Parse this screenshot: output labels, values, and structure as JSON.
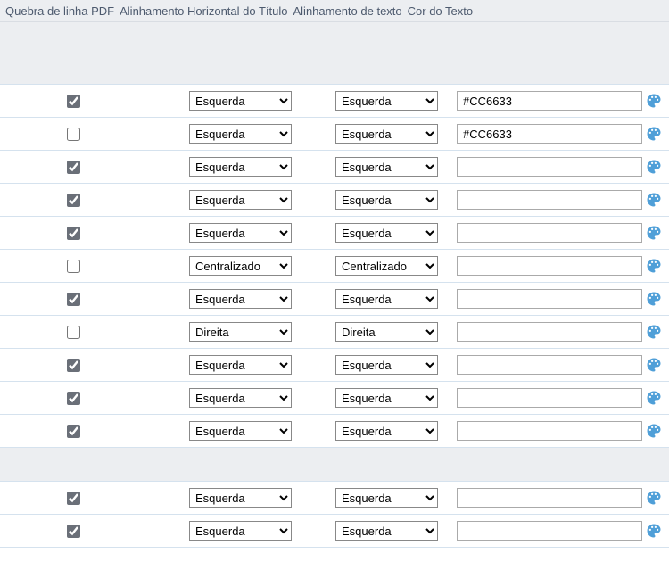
{
  "headers": {
    "col1": "Quebra de linha PDF",
    "col2": "Alinhamento Horizontal do Título",
    "col3": "Alinhamento de texto",
    "col4": "Cor do Texto"
  },
  "align_options": {
    "left": "Esquerda",
    "center": "Centralizado",
    "right": "Direita"
  },
  "rows_group1": [
    {
      "check": true,
      "align_title": "left",
      "align_text": "left",
      "color": "#CC6633"
    },
    {
      "check": false,
      "align_title": "left",
      "align_text": "left",
      "color": "#CC6633"
    },
    {
      "check": true,
      "align_title": "left",
      "align_text": "left",
      "color": ""
    },
    {
      "check": true,
      "align_title": "left",
      "align_text": "left",
      "color": ""
    },
    {
      "check": true,
      "align_title": "left",
      "align_text": "left",
      "color": ""
    },
    {
      "check": false,
      "align_title": "center",
      "align_text": "center",
      "color": ""
    },
    {
      "check": true,
      "align_title": "left",
      "align_text": "left",
      "color": ""
    },
    {
      "check": false,
      "align_title": "right",
      "align_text": "right",
      "color": ""
    },
    {
      "check": true,
      "align_title": "left",
      "align_text": "left",
      "color": ""
    },
    {
      "check": true,
      "align_title": "left",
      "align_text": "left",
      "color": ""
    },
    {
      "check": true,
      "align_title": "left",
      "align_text": "left",
      "color": ""
    }
  ],
  "rows_group2": [
    {
      "check": true,
      "align_title": "left",
      "align_text": "left",
      "color": ""
    },
    {
      "check": true,
      "align_title": "left",
      "align_text": "left",
      "color": ""
    }
  ]
}
